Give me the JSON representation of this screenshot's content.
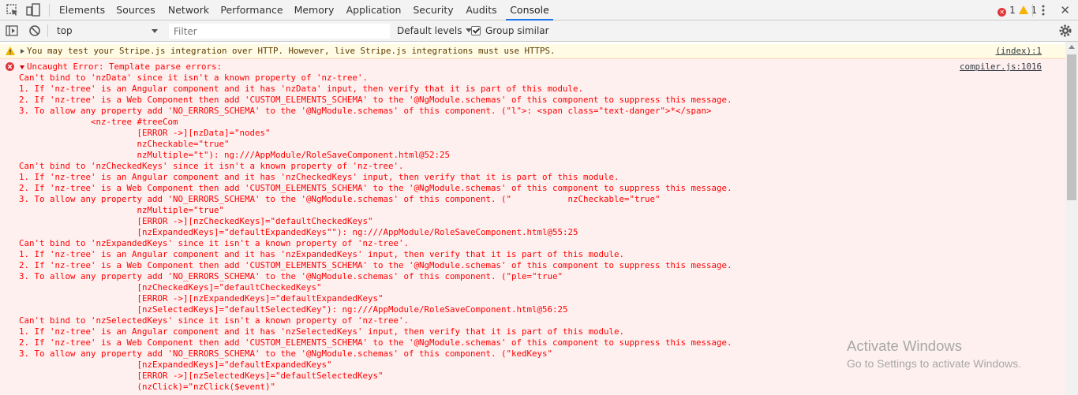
{
  "devtools": {
    "tabs": [
      "Elements",
      "Sources",
      "Network",
      "Performance",
      "Memory",
      "Application",
      "Security",
      "Audits",
      "Console"
    ],
    "active_tab": "Console",
    "error_count": "1",
    "warning_count": "1"
  },
  "console_toolbar": {
    "context": "top",
    "filter_placeholder": "Filter",
    "levels": "Default levels",
    "group_similar": "Group similar"
  },
  "messages": {
    "warning": {
      "text": "You may test your Stripe.js integration over HTTP. However, live Stripe.js integrations must use HTTPS.",
      "source": "(index):1"
    },
    "error": {
      "header": "Uncaught Error: Template parse errors:",
      "source": "compiler.js:1016",
      "lines": [
        "Can't bind to 'nzData' since it isn't a known property of 'nz-tree'.",
        "1. If 'nz-tree' is an Angular component and it has 'nzData' input, then verify that it is part of this module.",
        "2. If 'nz-tree' is a Web Component then add 'CUSTOM_ELEMENTS_SCHEMA' to the '@NgModule.schemas' of this component to suppress this message.",
        "3. To allow any property add 'NO_ERRORS_SCHEMA' to the '@NgModule.schemas' of this component. (\"l\">: <span class=\"text-danger\">*</span>",
        "              <nz-tree #treeCom",
        "                       [ERROR ->][nzData]=\"nodes\"",
        "                       nzCheckable=\"true\"",
        "                       nzMultiple=\"t\"): ng:///AppModule/RoleSaveComponent.html@52:25",
        "Can't bind to 'nzCheckedKeys' since it isn't a known property of 'nz-tree'.",
        "1. If 'nz-tree' is an Angular component and it has 'nzCheckedKeys' input, then verify that it is part of this module.",
        "2. If 'nz-tree' is a Web Component then add 'CUSTOM_ELEMENTS_SCHEMA' to the '@NgModule.schemas' of this component to suppress this message.",
        "3. To allow any property add 'NO_ERRORS_SCHEMA' to the '@NgModule.schemas' of this component. (\"           nzCheckable=\"true\"",
        "                       nzMultiple=\"true\"",
        "                       [ERROR ->][nzCheckedKeys]=\"defaultCheckedKeys\"",
        "                       [nzExpandedKeys]=\"defaultExpandedKeys\"\"): ng:///AppModule/RoleSaveComponent.html@55:25",
        "Can't bind to 'nzExpandedKeys' since it isn't a known property of 'nz-tree'.",
        "1. If 'nz-tree' is an Angular component and it has 'nzExpandedKeys' input, then verify that it is part of this module.",
        "2. If 'nz-tree' is a Web Component then add 'CUSTOM_ELEMENTS_SCHEMA' to the '@NgModule.schemas' of this component to suppress this message.",
        "3. To allow any property add 'NO_ERRORS_SCHEMA' to the '@NgModule.schemas' of this component. (\"ple=\"true\"",
        "                       [nzCheckedKeys]=\"defaultCheckedKeys\"",
        "                       [ERROR ->][nzExpandedKeys]=\"defaultExpandedKeys\"",
        "                       [nzSelectedKeys]=\"defaultSelectedKey\"): ng:///AppModule/RoleSaveComponent.html@56:25",
        "Can't bind to 'nzSelectedKeys' since it isn't a known property of 'nz-tree'.",
        "1. If 'nz-tree' is an Angular component and it has 'nzSelectedKeys' input, then verify that it is part of this module.",
        "2. If 'nz-tree' is a Web Component then add 'CUSTOM_ELEMENTS_SCHEMA' to the '@NgModule.schemas' of this component to suppress this message.",
        "3. To allow any property add 'NO_ERRORS_SCHEMA' to the '@NgModule.schemas' of this component. (\"kedKeys\"",
        "                       [nzExpandedKeys]=\"defaultExpandedKeys\"",
        "                       [ERROR ->][nzSelectedKeys]=\"defaultSelectedKeys\"",
        "                       (nzClick)=\"nzClick($event)\""
      ]
    }
  },
  "watermark": {
    "line1": "Activate Windows",
    "line2": "Go to Settings to activate Windows."
  }
}
